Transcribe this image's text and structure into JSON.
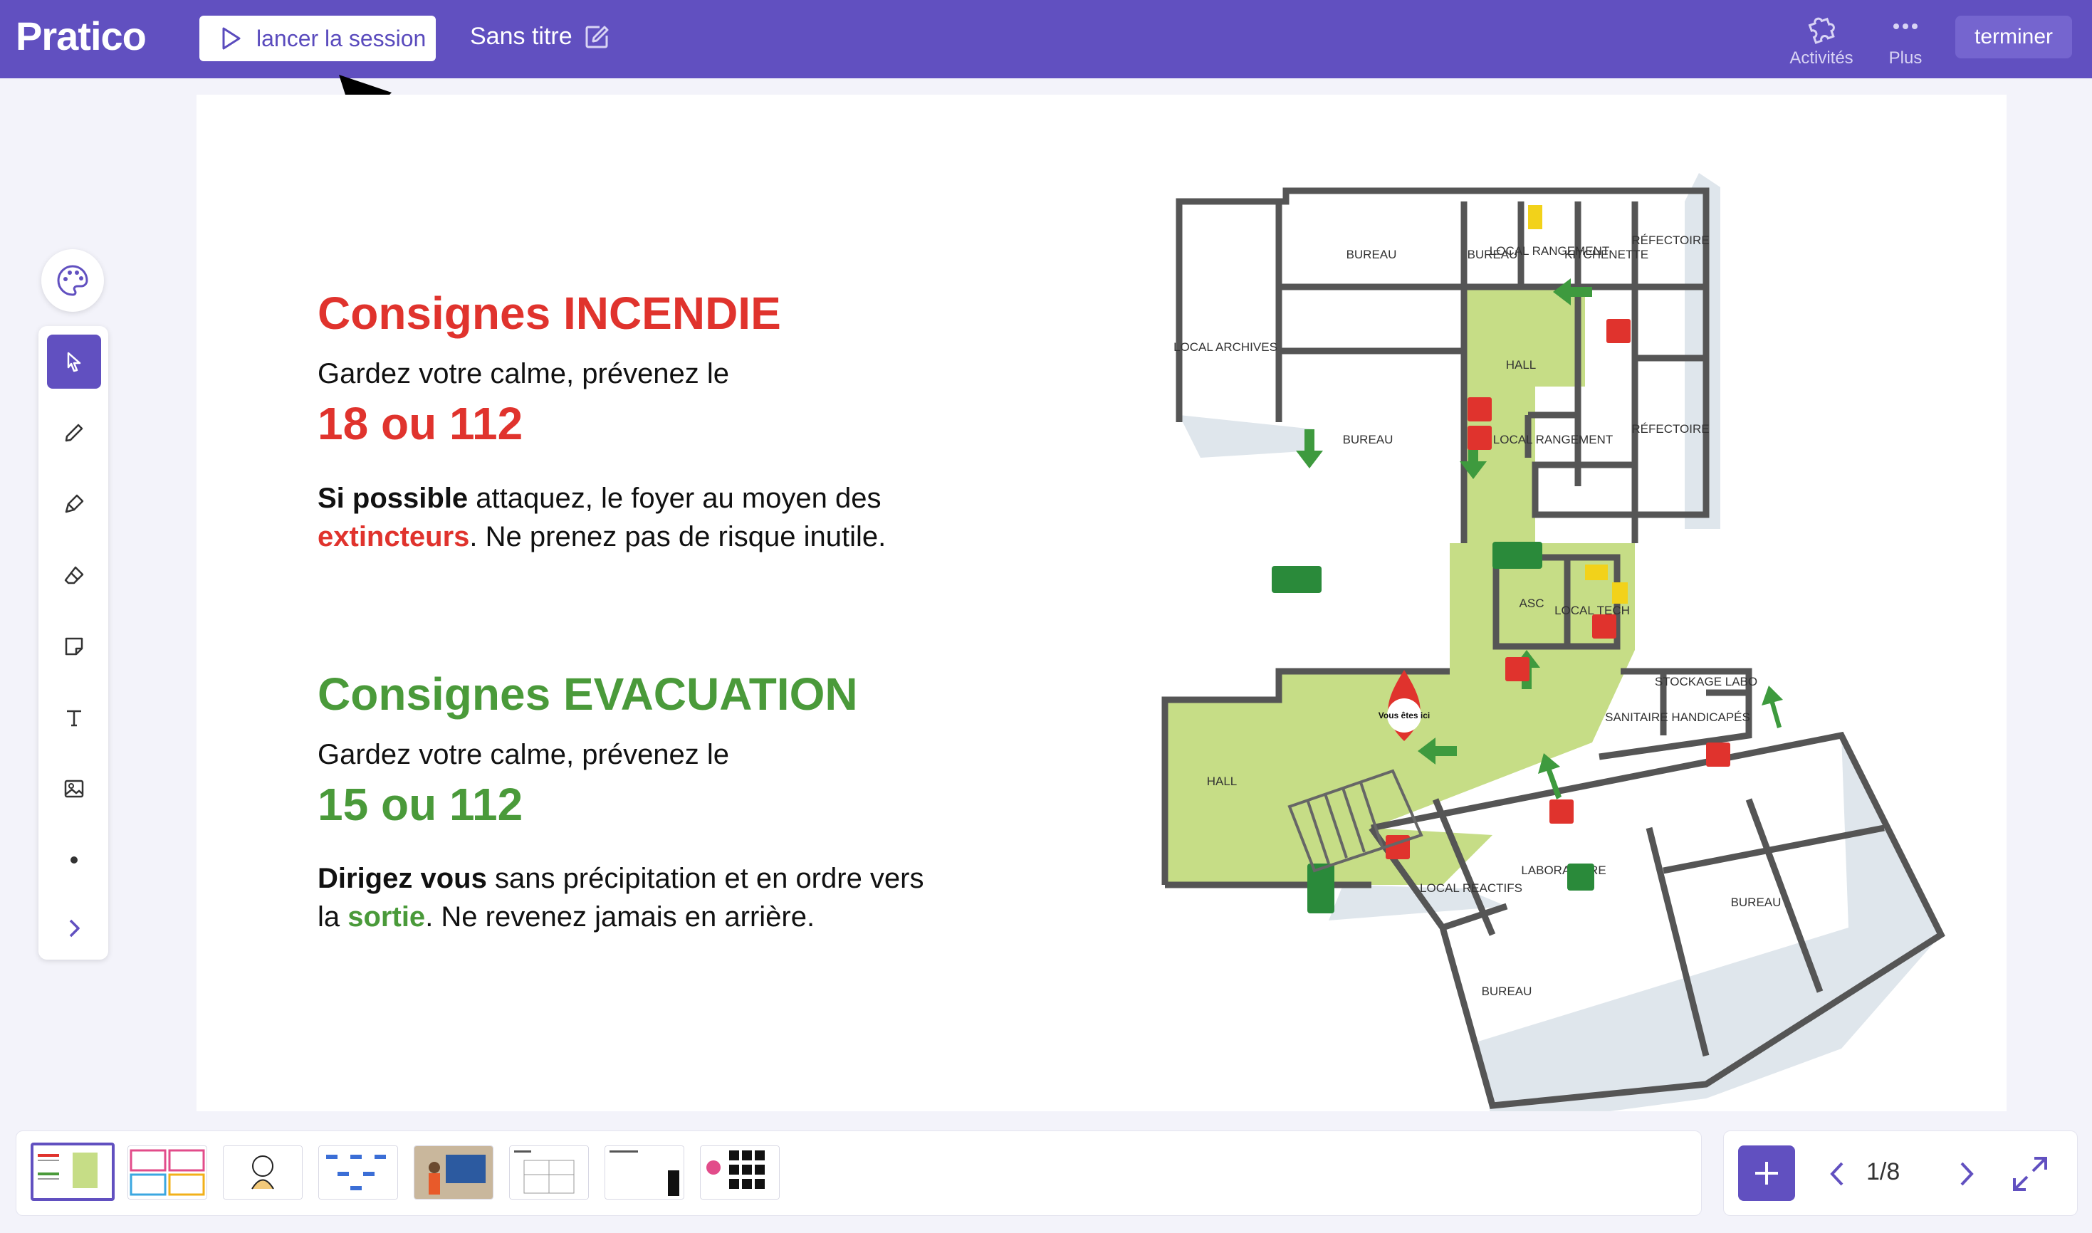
{
  "app": {
    "name": "Pratico"
  },
  "topbar": {
    "launch_label": "lancer la session",
    "doc_title": "Sans titre",
    "activities_label": "Activités",
    "more_label": "Plus",
    "finish_label": "terminer"
  },
  "slide": {
    "fire_title": "Consignes INCENDIE",
    "fire_line": "Gardez votre calme, prévenez le",
    "fire_number": "18 ou 112",
    "fire_bold": "Si possible",
    "fire_text1": " attaquez, le foyer au moyen des",
    "fire_red": "extincteurs",
    "fire_text2": ". Ne prenez pas de risque inutile.",
    "evac_title": "Consignes EVACUATION",
    "evac_line": "Gardez votre calme, prévenez le",
    "evac_number": "15 ou 112",
    "evac_bold": "Dirigez vous",
    "evac_text1": " sans précipitation et en ordre vers",
    "evac_text2a": "la ",
    "evac_green": "sortie",
    "evac_text2b": ". Ne revenez jamais en arrière.",
    "map_labels": {
      "bureau1": "BUREAU",
      "bureau2": "BUREAU",
      "local_rangement1": "LOCAL RANGEMENT",
      "kitchenette": "KITCHENETTE",
      "refectoire1": "RÉFECTOIRE",
      "local_archives": "LOCAL ARCHIVES",
      "hall1": "HALL",
      "bureau3": "BUREAU",
      "local_rangement2": "LOCAL RANGEMENT",
      "refectoire2": "RÉFECTOIRE",
      "asc": "ASC",
      "local_tech": "LOCAL TECH",
      "stockage": "STOCKAGE LABO",
      "sanitaire": "SANITAIRE HANDICAPÉS",
      "hall2": "HALL",
      "you_are_here": "Vous êtes ici",
      "local_reactifs": "LOCAL REACTIFS",
      "laboratoire": "LABORATOIRE",
      "bureau4": "BUREAU",
      "bureau5": "BUREAU"
    }
  },
  "pagination": {
    "label": "1/8"
  },
  "colors": {
    "brand": "#6150c0",
    "fire": "#e0332d",
    "evac": "#4a9a3a",
    "map_green": "#c6dd86"
  }
}
